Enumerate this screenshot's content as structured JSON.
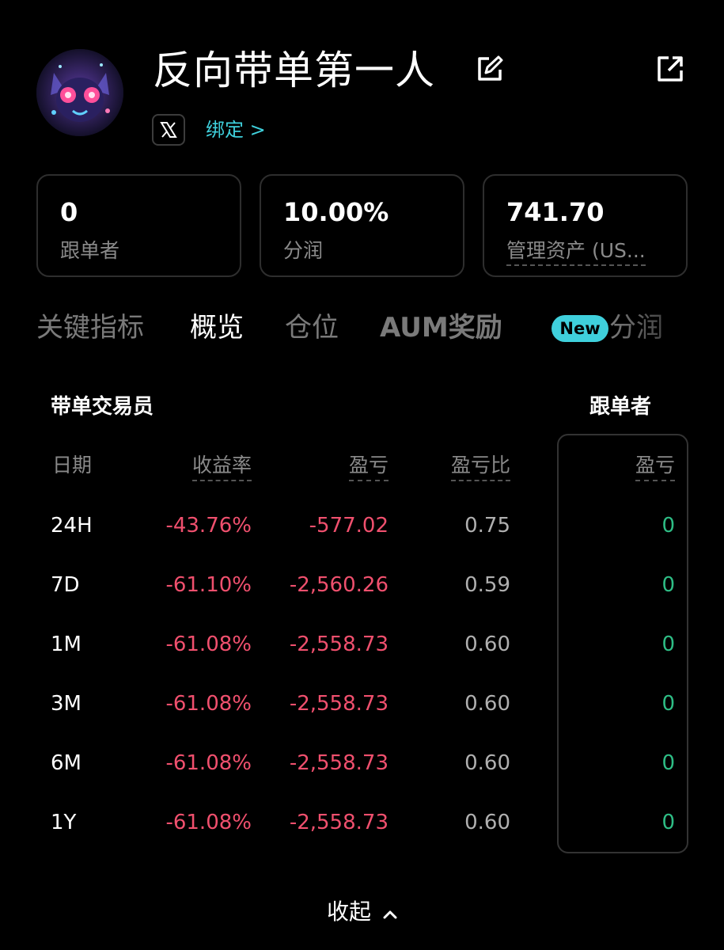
{
  "profile": {
    "name": "反向带单第一人",
    "social_icon": "x-icon",
    "bind_link": "绑定 >"
  },
  "stats": [
    {
      "value": "0",
      "label": "跟单者"
    },
    {
      "value": "10.00%",
      "label": "分润"
    },
    {
      "value": "741.70",
      "label": "管理资产 (US..."
    }
  ],
  "tabs": {
    "items": [
      "关键指标",
      "概览",
      "仓位",
      "AUM奖励",
      "分润"
    ],
    "active": "概览",
    "new_badge": "New"
  },
  "table": {
    "trader_heading": "带单交易员",
    "follower_heading": "跟单者",
    "columns": [
      "日期",
      "收益率",
      "盈亏",
      "盈亏比",
      "盈亏"
    ],
    "rows": [
      {
        "period": "24H",
        "roi": "-43.76%",
        "pnl": "-577.02",
        "ratio": "0.75",
        "follower_pnl": "0"
      },
      {
        "period": "7D",
        "roi": "-61.10%",
        "pnl": "-2,560.26",
        "ratio": "0.59",
        "follower_pnl": "0"
      },
      {
        "period": "1M",
        "roi": "-61.08%",
        "pnl": "-2,558.73",
        "ratio": "0.60",
        "follower_pnl": "0"
      },
      {
        "period": "3M",
        "roi": "-61.08%",
        "pnl": "-2,558.73",
        "ratio": "0.60",
        "follower_pnl": "0"
      },
      {
        "period": "6M",
        "roi": "-61.08%",
        "pnl": "-2,558.73",
        "ratio": "0.60",
        "follower_pnl": "0"
      },
      {
        "period": "1Y",
        "roi": "-61.08%",
        "pnl": "-2,558.73",
        "ratio": "0.60",
        "follower_pnl": "0"
      }
    ]
  },
  "collapse_label": "收起",
  "colors": {
    "accent": "#3fd0dc",
    "negative": "#f0506e",
    "positive": "#2ebd85"
  }
}
